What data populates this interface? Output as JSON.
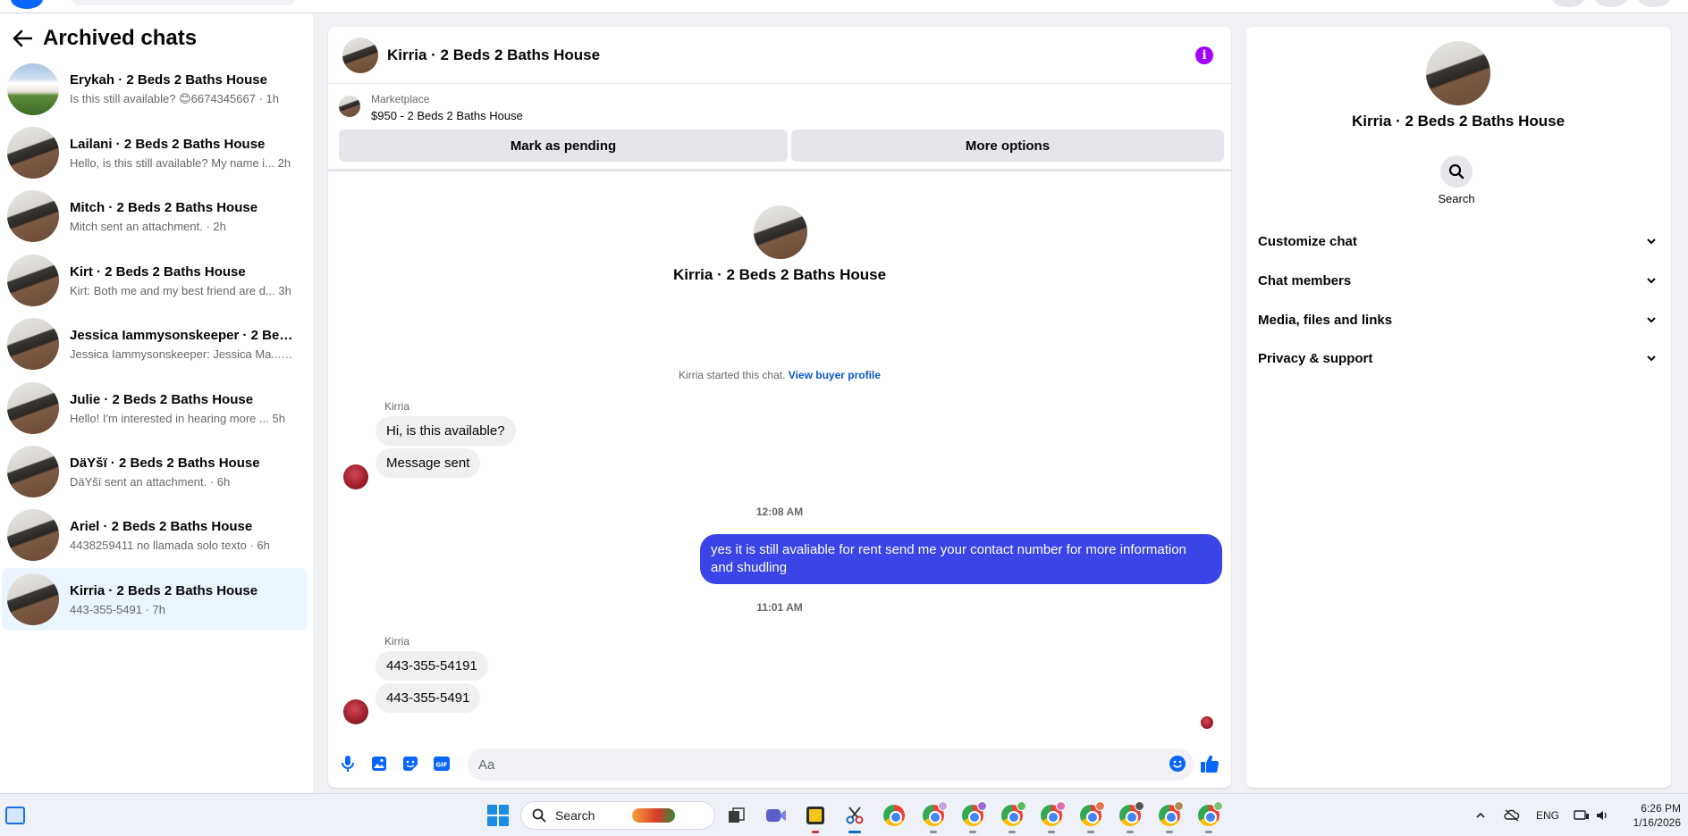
{
  "sidebar": {
    "title": "Archived chats",
    "conversations": [
      {
        "name": "Erykah · 2 Beds 2 Baths House",
        "preview": "Is this still available? 😊6674345667 · 1h",
        "avatar": "house-photo"
      },
      {
        "name": "Lailani · 2 Beds 2 Baths House",
        "preview": "Hello, is this still available? My name i...  2h",
        "avatar": "room-photo"
      },
      {
        "name": "Mitch · 2 Beds 2 Baths House",
        "preview": "Mitch sent an attachment. · 2h",
        "avatar": "room-photo"
      },
      {
        "name": "Kirt · 2 Beds 2 Baths House",
        "preview": "Kirt: Both me and my best friend are d...  3h",
        "avatar": "room-photo"
      },
      {
        "name": "Jessica Iammysonskeeper · 2 Beds ...",
        "preview": "Jessica Iammysonskeeper: Jessica Ma...  · 4h",
        "avatar": "room-photo"
      },
      {
        "name": "Julie · 2 Beds 2 Baths House",
        "preview": "Hello! I'm interested in hearing more ...  5h",
        "avatar": "room-photo"
      },
      {
        "name": "DäYšï · 2 Beds 2 Baths House",
        "preview": "DäYšï sent an attachment. · 6h",
        "avatar": "room-photo"
      },
      {
        "name": "Ariel · 2 Beds 2 Baths House",
        "preview": "4438259411 no llamada solo texto · 6h",
        "avatar": "room-photo"
      },
      {
        "name": "Kirria · 2 Beds 2 Baths House",
        "preview": "443-355-5491 · 7h",
        "avatar": "room-photo",
        "active": true
      }
    ]
  },
  "chat": {
    "header_title": "Kirria · 2 Beds 2 Baths House",
    "marketplace_label": "Marketplace",
    "listing": "$950 - 2 Beds 2 Baths House",
    "mark_pending": "Mark as pending",
    "more_options": "More options",
    "intro_name": "Kirria · 2 Beds 2 Baths House",
    "started_text": "Kirria started this chat.",
    "view_buyer_profile": "View buyer profile",
    "messages": [
      {
        "sender": "Kirria",
        "text": "Hi, is this available?"
      },
      {
        "text": "Message sent"
      },
      {
        "timestamp": "12:08 AM"
      },
      {
        "outgoing": true,
        "text": "yes it is still avaliable for rent send me your contact number for more information and shudling"
      },
      {
        "timestamp": "11:01 AM"
      },
      {
        "sender": "Kirria",
        "text": "443-355-54191"
      },
      {
        "text": "443-355-5491"
      }
    ],
    "composer_placeholder": "Aa"
  },
  "info_panel": {
    "name": "Kirria · 2 Beds 2 Baths House",
    "search_label": "Search",
    "sections": [
      "Customize chat",
      "Chat members",
      "Media, files and links",
      "Privacy & support"
    ]
  },
  "taskbar": {
    "search_placeholder": "Search",
    "language": "ENG",
    "time": "6:26 PM",
    "date": "1/16/2026"
  },
  "colors": {
    "outgoing_bubble": "#3a45e7",
    "info_icon": "#a300ff",
    "active_row": "#ebf5ff",
    "link": "#0a58ca",
    "composer_icons": "#0866ff"
  }
}
